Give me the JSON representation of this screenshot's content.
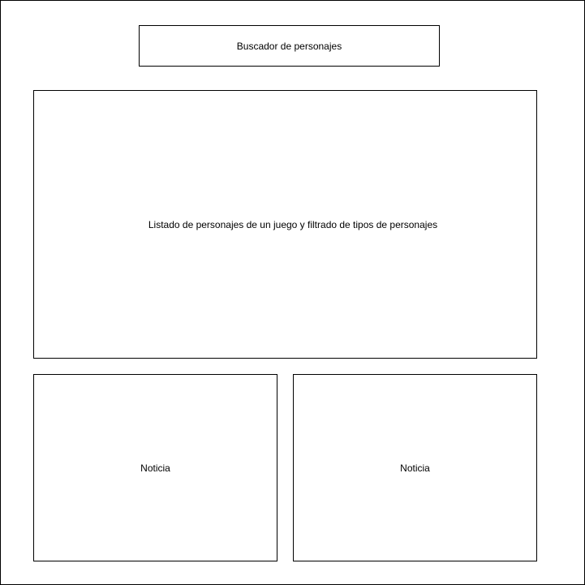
{
  "wireframe": {
    "search_box": {
      "label": "Buscador de personajes"
    },
    "character_list": {
      "label": "Listado de personajes de un juego y filtrado de tipos de personajes"
    },
    "news": [
      {
        "label": "Noticia"
      },
      {
        "label": "Noticia"
      }
    ]
  }
}
